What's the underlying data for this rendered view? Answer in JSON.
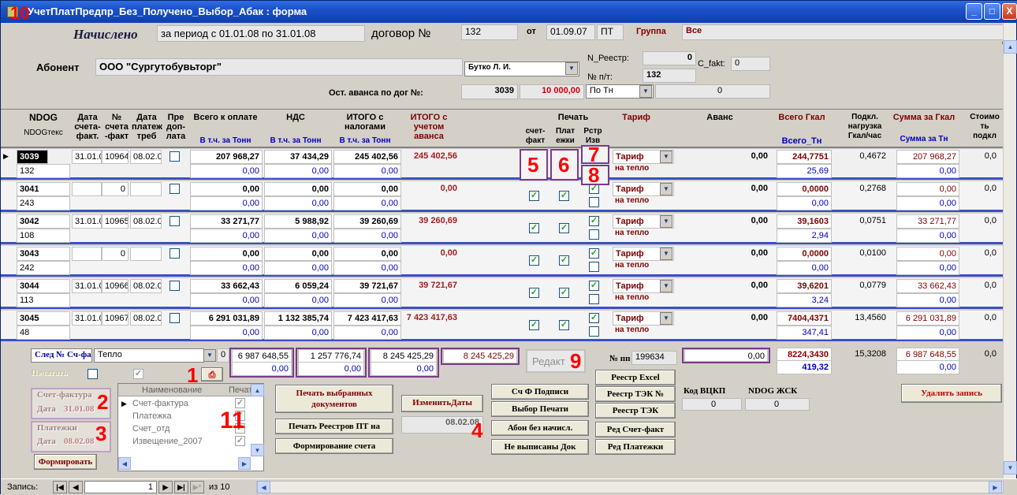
{
  "window": {
    "title": "УчетПлатПредпр_Без_Получено_Выбор_Абак : форма",
    "annotation": "10",
    "controls": [
      "_",
      "□",
      "X"
    ]
  },
  "header": {
    "accrued_label": "Начислено",
    "period_text": "за период с 01.01.08 по 31.01.08",
    "contract_label": "договор №",
    "contract_no": "132",
    "from_label": "от",
    "contract_date": "01.09.07",
    "contract_type": "ПТ",
    "group_label": "Группа",
    "group_value": "Все",
    "subscriber_label": "Абонент",
    "subscriber_name": "ООО \"Сургутобувьторг\"",
    "manager": "Бутко Л. И.",
    "n_reestr_label": "N_Реестр:",
    "n_reestr_value": "0",
    "c_fakt_label": "C_fakt:",
    "c_fakt_value": "0",
    "np_label": "№ п/т:",
    "np_value": "132",
    "advance_rest_label": "Ост. аванса по дог №:",
    "advance_rest_contract": "3039",
    "advance_rest_value": "10 000,00",
    "per_tn_select": "По Тн",
    "per_tn_value": "0",
    "edge_letter": "С"
  },
  "columns": {
    "ndog": "NDOG",
    "ndogtext": "NDOGтекс",
    "date_invoice": "Дата счета-факт.",
    "invoice_no": "№ счета -факт",
    "date_payreq": "Дата платеж треб",
    "prepay": "Пре доп-лата",
    "total_to_pay": "Всего к оплате",
    "vat": "НДС",
    "total_with_tax": "ИТОГО с налогами",
    "total_with_advance": "ИТОГО с учетом аванса",
    "print": "Печать",
    "print_invoice": "счет-факт",
    "print_payment": "Плат ежки",
    "print_reestr": "Рстр Изв",
    "tariff": "Тариф",
    "advance": "Аванс",
    "total_gcal": "Всего Гкал",
    "total_tn": "Всего_Тн",
    "connected_load": "Подкл. нагрузка Гкал/час",
    "sum_gcal": "Сумма за Гкал",
    "sum_tn": "Сумма за Тн",
    "cost_conn": "Стоимо ть подкл",
    "incl_tn_1": "В т.ч. за Тонн",
    "incl_tn_2": "В т.ч. за Тонн",
    "incl_tn_3": "В т.ч. за Тонн"
  },
  "records": [
    {
      "ndog": "3039",
      "ndogtext": "132",
      "date_invoice": "31.01.08",
      "invoice_no": "10964",
      "date_payreq": "08.02.08",
      "total": "207 968,27",
      "total_tn": "0,00",
      "vat": "37 434,29",
      "vat_tn": "0,00",
      "total_tax": "245 402,56",
      "total_tax_tn": "0,00",
      "total_adv": "245 402,56",
      "tariff": "Тариф",
      "tariff2": "на тепло",
      "advance": "0,00",
      "gcal": "244,7751",
      "tn": "25,69",
      "load": "0,4672",
      "sum_gcal": "207 968,27",
      "sum_tn": "0,00",
      "cost": "0,0"
    },
    {
      "ndog": "3041",
      "ndogtext": "243",
      "date_invoice": "",
      "invoice_no": "0",
      "date_payreq": "",
      "total": "0,00",
      "total_tn": "0,00",
      "vat": "0,00",
      "vat_tn": "0,00",
      "total_tax": "0,00",
      "total_tax_tn": "0,00",
      "total_adv": "0,00",
      "tariff": "Тариф",
      "tariff2": "на тепло",
      "advance": "0,00",
      "gcal": "0,0000",
      "tn": "0,00",
      "load": "0,2768",
      "sum_gcal": "0,00",
      "sum_tn": "0,00",
      "cost": "0,0"
    },
    {
      "ndog": "3042",
      "ndogtext": "108",
      "date_invoice": "31.01.08",
      "invoice_no": "10965",
      "date_payreq": "08.02.08",
      "total": "33 271,77",
      "total_tn": "0,00",
      "vat": "5 988,92",
      "vat_tn": "0,00",
      "total_tax": "39 260,69",
      "total_tax_tn": "0,00",
      "total_adv": "39 260,69",
      "tariff": "Тариф",
      "tariff2": "на тепло",
      "advance": "0,00",
      "gcal": "39,1603",
      "tn": "2,94",
      "load": "0,0751",
      "sum_gcal": "33 271,77",
      "sum_tn": "0,00",
      "cost": "0,0"
    },
    {
      "ndog": "3043",
      "ndogtext": "242",
      "date_invoice": "",
      "invoice_no": "0",
      "date_payreq": "",
      "total": "0,00",
      "total_tn": "0,00",
      "vat": "0,00",
      "vat_tn": "0,00",
      "total_tax": "0,00",
      "total_tax_tn": "0,00",
      "total_adv": "0,00",
      "tariff": "Тариф",
      "tariff2": "на тепло",
      "advance": "0,00",
      "gcal": "0,0000",
      "tn": "0,00",
      "load": "0,0100",
      "sum_gcal": "0,00",
      "sum_tn": "0,00",
      "cost": "0,0"
    },
    {
      "ndog": "3044",
      "ndogtext": "113",
      "date_invoice": "31.01.08",
      "invoice_no": "10966",
      "date_payreq": "08.02.08",
      "total": "33 662,43",
      "total_tn": "0,00",
      "vat": "6 059,24",
      "vat_tn": "0,00",
      "total_tax": "39 721,67",
      "total_tax_tn": "0,00",
      "total_adv": "39 721,67",
      "tariff": "Тариф",
      "tariff2": "на тепло",
      "advance": "0,00",
      "gcal": "39,6201",
      "tn": "3,24",
      "load": "0,0779",
      "sum_gcal": "33 662,43",
      "sum_tn": "0,00",
      "cost": "0,0"
    },
    {
      "ndog": "3045",
      "ndogtext": "48",
      "date_invoice": "31.01.08",
      "invoice_no": "10967",
      "date_payreq": "08.02.08",
      "total": "6 291 031,89",
      "total_tn": "0,00",
      "vat": "1 132 385,74",
      "vat_tn": "0,00",
      "total_tax": "7 423 417,63",
      "total_tax_tn": "0,00",
      "total_adv": "7 423 417,63",
      "tariff": "Тариф",
      "tariff2": "на тепло",
      "advance": "0,00",
      "gcal": "7404,4371",
      "tn": "347,41",
      "load": "13,4560",
      "sum_gcal": "6 291 031,89",
      "sum_tn": "0,00",
      "cost": "0,0"
    }
  ],
  "footer": {
    "next_invoice_label": "След № Сч-факт",
    "heat_select": "Тепло",
    "heat_value": "0",
    "sum_total": "6 987 648,55",
    "sum_total_tn": "0,00",
    "sum_vat": "1 257 776,74",
    "sum_vat_tn": "0,00",
    "sum_total_tax": "8 245 425,29",
    "sum_total_tax_tn": "0,00",
    "sum_total_adv": "8 245 425,29",
    "edit_label": "Редакт",
    "np_label": "№ пп",
    "np_value": "199634",
    "advance_total": "0,00",
    "gcal_total": "8224,3430",
    "tn_total": "419,32",
    "load_total": "15,3208",
    "sum_gcal_total": "6 987 648,55",
    "sum_tn_total": "0,00",
    "cost_total": "0,0",
    "print_label": "Печатать",
    "invoice_group": "Счет-фактура",
    "invoice_date_label": "Дата",
    "invoice_date": "31.01.08",
    "payment_group": "Платежки",
    "payment_date_label": "Дата",
    "payment_date": "08.02.08",
    "form_button": "Формировать",
    "print_selected": "Печать выбранных документов",
    "print_registers": "Печать Реестров ПТ на",
    "form_invoice": "Формирование счета",
    "change_dates": "ИзменитьДаты",
    "change_date_value": "08.02.08",
    "invoice_signatures": "Сч Ф Подписи",
    "print_choice": "Выбор Печати",
    "no_accruals": "Абон без начисл.",
    "not_issued": "Не выписаны Док",
    "reestr_excel": "Реестр Excel",
    "reestr_tek_no": "Реестр ТЭК №",
    "reestr_tek": "Реестр ТЭК",
    "edit_invoice": "Ред Счет-факт",
    "edit_payments": "Ред Платежки",
    "code_vckp_label": "Код ВЦКП",
    "code_vckp_value": "0",
    "ndog_zhsk_label": "NDOG ЖСК",
    "ndog_zhsk_value": "0",
    "delete_record": "Удалить запись"
  },
  "subform": {
    "col_name": "Наименование",
    "col_print": "Печат",
    "rows": [
      {
        "name": "Счет-фактура",
        "checked": true
      },
      {
        "name": "Платежка",
        "checked": true
      },
      {
        "name": "Счет_отд",
        "checked": true
      },
      {
        "name": "Извещение_2007",
        "checked": true
      }
    ]
  },
  "annotations": [
    "1",
    "2",
    "3",
    "4",
    "5",
    "6",
    "7",
    "8",
    "9",
    "10",
    "11"
  ],
  "statusbar": {
    "record_label": "Запись:",
    "current": "1",
    "of_label": "из 10"
  }
}
